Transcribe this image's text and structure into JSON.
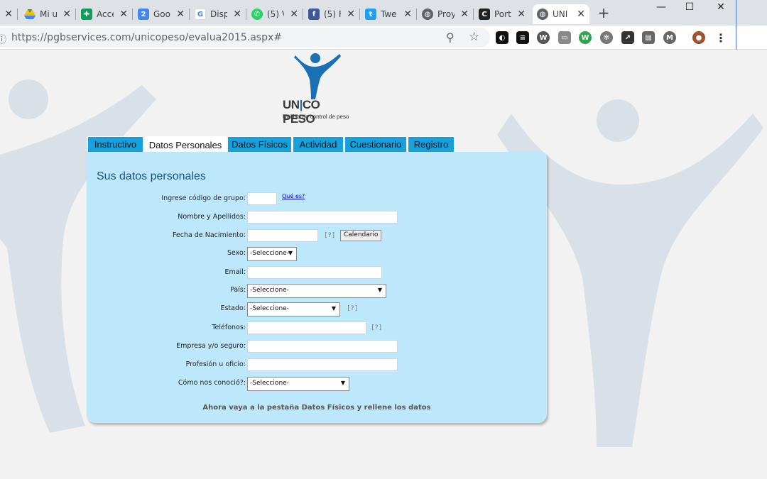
{
  "browser": {
    "tabs": [
      {
        "title": "",
        "icon": "generic-icon",
        "color": "#5f6368"
      },
      {
        "title": "Mi u",
        "icon": "google-drive-icon",
        "color": "#1fa463"
      },
      {
        "title": "Acce",
        "icon": "google-sheets-icon",
        "color": "#0f9d58"
      },
      {
        "title": "Goo",
        "icon": "google-calendar-icon",
        "color": "#4285f4"
      },
      {
        "title": "Disp",
        "icon": "google-icon",
        "color": "#ea4335"
      },
      {
        "title": "(5) V",
        "icon": "whatsapp-icon",
        "color": "#25d366"
      },
      {
        "title": "(5) F",
        "icon": "facebook-icon",
        "color": "#3b5998"
      },
      {
        "title": "Twe",
        "icon": "twitter-icon",
        "color": "#1da1f2"
      },
      {
        "title": "Proy",
        "icon": "globe-icon",
        "color": "#5f6368"
      },
      {
        "title": "Port",
        "icon": "portal-icon",
        "color": "#222222"
      },
      {
        "title": "UNI",
        "icon": "globe-icon",
        "color": "#5f6368"
      }
    ],
    "url": "https://pgbservices.com/unicopeso/evalua2015.aspx#"
  },
  "logo": {
    "word_left": "UN",
    "word_mid": "CO",
    "word_right": "PESO",
    "tagline": "Unidad de control de peso"
  },
  "nav_tabs": [
    {
      "label": "Instructivo"
    },
    {
      "label": "Datos Personales"
    },
    {
      "label": "Datos Físicos"
    },
    {
      "label": "Actividad"
    },
    {
      "label": "Cuestionario"
    },
    {
      "label": "Registro"
    }
  ],
  "form": {
    "heading": "Sus datos personales",
    "group_code_label": "Ingrese código de grupo:",
    "group_code_help": "Qué es?",
    "name_label": "Nombre y Apellidos:",
    "birth_label": "Fecha de Nacimiento:",
    "birth_help": "[?]",
    "calendar_button": "Calendario",
    "sex_label": "Sexo:",
    "sex_value": "-Seleccione-",
    "email_label": "Email:",
    "country_label": "País:",
    "country_value": "-Seleccione-",
    "state_label": "Estado:",
    "state_value": "-Seleccione-",
    "state_help": "[?]",
    "phones_label": "Teléfonos:",
    "phones_help": "[?]",
    "company_label": "Empresa y/o seguro:",
    "profession_label": "Profesión u oficio:",
    "source_label": "Cómo nos conoció?:",
    "source_value": "-Seleccione-",
    "footnote": "Ahora vaya a la pestaña Datos Físicos y rellene los datos"
  }
}
